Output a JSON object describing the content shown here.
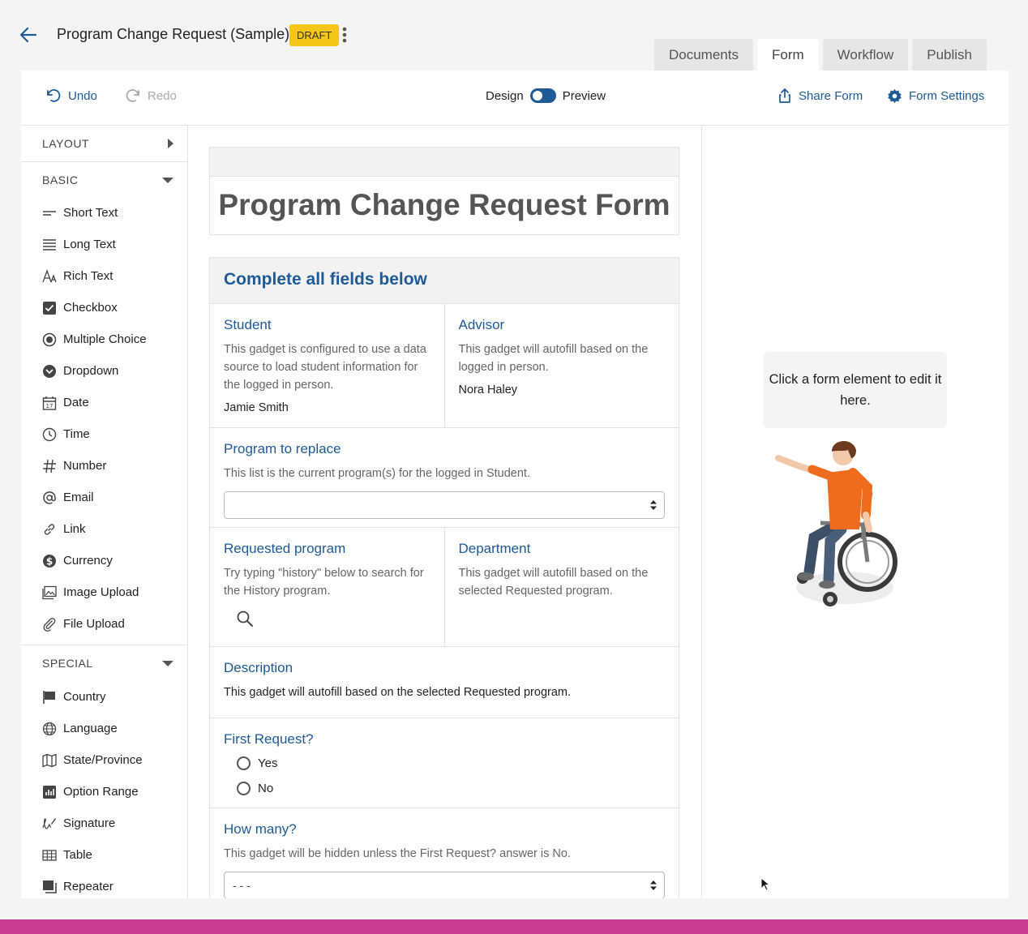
{
  "header": {
    "title": "Program Change Request (Sample)",
    "badge": "DRAFT",
    "tabs": [
      "Documents",
      "Form",
      "Workflow",
      "Publish"
    ],
    "active_tab": "Form"
  },
  "toolbar": {
    "undo": "Undo",
    "redo": "Redo",
    "design": "Design",
    "preview": "Preview",
    "share": "Share Form",
    "settings": "Form Settings"
  },
  "sidebar": {
    "layout": "LAYOUT",
    "basic": "BASIC",
    "basic_items": [
      {
        "label": "Short Text",
        "icon": "short-text-icon"
      },
      {
        "label": "Long Text",
        "icon": "long-text-icon"
      },
      {
        "label": "Rich Text",
        "icon": "rich-text-icon"
      },
      {
        "label": "Checkbox",
        "icon": "checkbox-icon"
      },
      {
        "label": "Multiple Choice",
        "icon": "radio-icon"
      },
      {
        "label": "Dropdown",
        "icon": "dropdown-icon"
      },
      {
        "label": "Date",
        "icon": "calendar-icon"
      },
      {
        "label": "Time",
        "icon": "clock-icon"
      },
      {
        "label": "Number",
        "icon": "hash-icon"
      },
      {
        "label": "Email",
        "icon": "at-icon"
      },
      {
        "label": "Link",
        "icon": "link-icon"
      },
      {
        "label": "Currency",
        "icon": "dollar-icon"
      },
      {
        "label": "Image Upload",
        "icon": "image-icon"
      },
      {
        "label": "File Upload",
        "icon": "paperclip-icon"
      }
    ],
    "special": "SPECIAL",
    "special_items": [
      {
        "label": "Country",
        "icon": "flag-icon"
      },
      {
        "label": "Language",
        "icon": "globe-icon"
      },
      {
        "label": "State/Province",
        "icon": "map-icon"
      },
      {
        "label": "Option Range",
        "icon": "bar-chart-icon"
      },
      {
        "label": "Signature",
        "icon": "signature-icon"
      },
      {
        "label": "Table",
        "icon": "table-icon"
      },
      {
        "label": "Repeater",
        "icon": "repeater-icon"
      }
    ]
  },
  "form": {
    "title": "Program Change Request Form",
    "section_heading": "Complete all fields below",
    "student": {
      "label": "Student",
      "desc": "This gadget is configured to use a data source to load student information for the logged in person.",
      "value": "Jamie Smith"
    },
    "advisor": {
      "label": "Advisor",
      "desc": "This gadget will autofill based on the logged in person.",
      "value": "Nora Haley"
    },
    "program_replace": {
      "label": "Program to replace",
      "desc": "This list is the current program(s) for the logged in Student."
    },
    "requested": {
      "label": "Requested program",
      "desc": "Try typing \"history\" below to search for the History program."
    },
    "department": {
      "label": "Department",
      "desc": "This gadget will autofill based on the selected Requested program."
    },
    "description": {
      "label": "Description",
      "desc": "This gadget will autofill based on the selected Requested program."
    },
    "first_request": {
      "label": "First Request?",
      "options": [
        "Yes",
        "No"
      ]
    },
    "how_many": {
      "label": "How many?",
      "desc": "This gadget will be hidden unless the First Request? answer is No.",
      "value": "- - -"
    }
  },
  "right_panel": {
    "hint": "Click a form element to edit it here."
  },
  "colors": {
    "accent": "#1e5a96",
    "badge": "#f5c518",
    "strip": "#c83d93"
  }
}
